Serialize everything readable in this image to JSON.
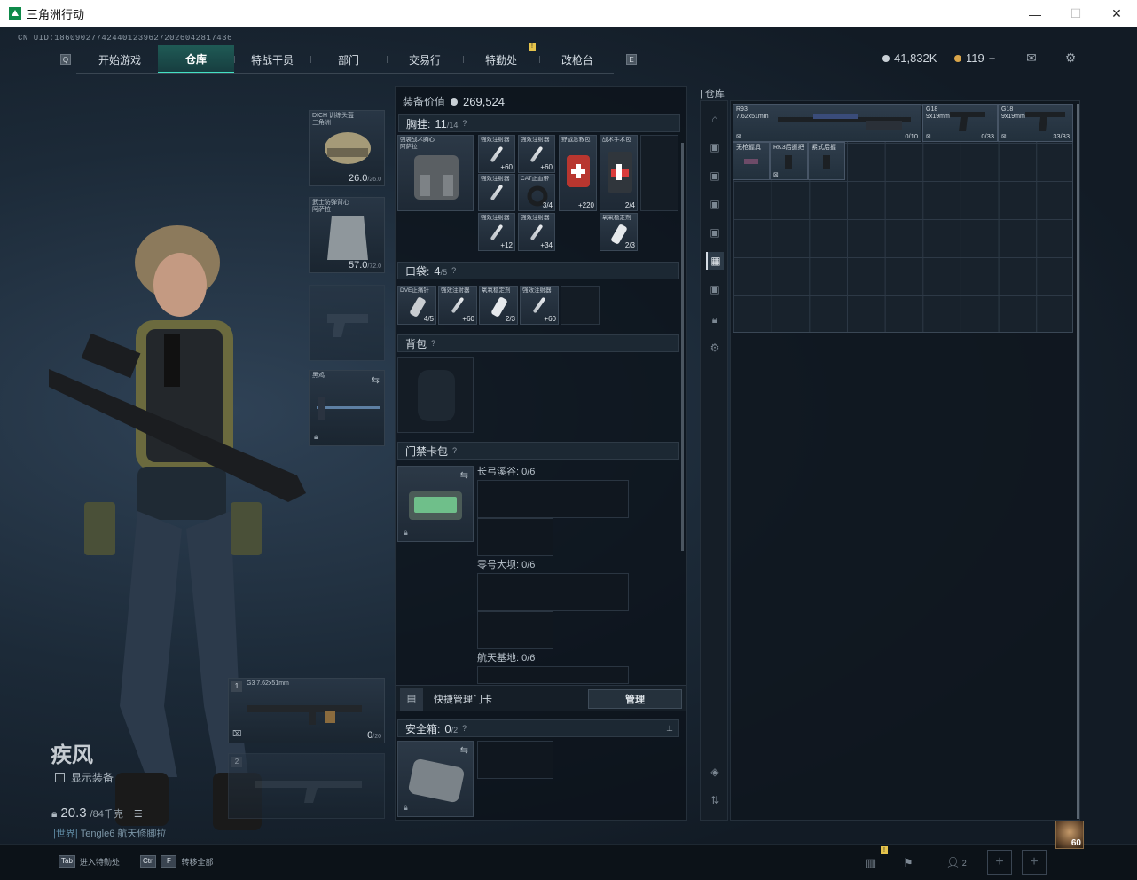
{
  "window": {
    "title": "三角洲行动",
    "minimize": "—",
    "maximize": "☐",
    "close": "✕"
  },
  "uid": "CN UID:1860902774244012396272026042817436",
  "nav": {
    "tabs": [
      {
        "label": "开始游戏"
      },
      {
        "label": "仓库"
      },
      {
        "label": "特战干员"
      },
      {
        "label": "部门"
      },
      {
        "label": "交易行"
      },
      {
        "label": "特勤处"
      },
      {
        "label": "改枪台"
      }
    ],
    "left_key": "Q",
    "right_key": "E",
    "badge": "!"
  },
  "currency": {
    "coins": "41,832K",
    "premium": "119",
    "plus": "+"
  },
  "character": {
    "name": "疾风",
    "show_equipment": "显示装备",
    "weight": "20.3",
    "weight_max": "/84千克",
    "chat_prefix": "|世界|",
    "chat_user": "Tengle6",
    "chat_text": "航天修脚拉"
  },
  "equipment": {
    "helmet": {
      "label": "DICH 训练头盔\n三角洲",
      "durability": "26.0",
      "max": "/26.0"
    },
    "armor": {
      "label": "武士防弹背心\n阿萨拉",
      "durability": "57.0",
      "max": "/72.0"
    },
    "melee": {
      "label": "黑鸡"
    },
    "primary": {
      "index": "1",
      "label": "G3\n7.62x51mm",
      "ammo": "0",
      "ammo_max": "/20"
    },
    "secondary": {
      "index": "2"
    }
  },
  "middle": {
    "value_label": "装备价值",
    "value": "269,524",
    "chest": {
      "title": "胸挂:",
      "cap": "11",
      "cap_max": "/14",
      "rig_label": "强袭战术胸心\n阿萨拉"
    },
    "chest_items": [
      {
        "label": "强效注射器",
        "count": "+60"
      },
      {
        "label": "强效注射器",
        "count": "+60"
      },
      {
        "label": "野战急救包",
        "count": "+220"
      },
      {
        "label": "战术手术包",
        "count": "2/4"
      },
      {
        "label": "强效注射器",
        "count": "+60"
      },
      {
        "label": "CAT止血带",
        "count": "3/4"
      },
      {
        "label": "强效注射器",
        "count": "+12"
      },
      {
        "label": "强效注射器",
        "count": "+34"
      },
      {
        "label": "氧氧稳定剂",
        "count": "2/3"
      }
    ],
    "pocket": {
      "title": "口袋:",
      "cap": "4",
      "cap_max": "/5"
    },
    "pocket_items": [
      {
        "label": "DVE止痛针",
        "count": "4/5"
      },
      {
        "label": "强效注射器",
        "count": "+60"
      },
      {
        "label": "氧氧稳定剂",
        "count": "2/3"
      },
      {
        "label": "强效注射器",
        "count": "+60"
      }
    ],
    "backpack": {
      "title": "背包"
    },
    "keycard": {
      "title": "门禁卡包",
      "areas": [
        {
          "label": "长弓溪谷: 0/6"
        },
        {
          "label": "零号大坝: 0/6"
        },
        {
          "label": "航天基地: 0/6"
        }
      ]
    },
    "quick_card": {
      "label": "快捷管理门卡",
      "button": "管理"
    },
    "safebox": {
      "title": "安全箱:",
      "cap": "0",
      "cap_max": "/2",
      "pin": "📌"
    },
    "help": "?"
  },
  "warehouse": {
    "title": "仓库",
    "items": [
      {
        "label": "R93\n7.62x51mm",
        "count": "0/10"
      },
      {
        "label": "G18\n9x19mm",
        "count": "0/33"
      },
      {
        "label": "G18\n9x19mm",
        "count": "33/33"
      },
      {
        "label": "无枪握具",
        "count": ""
      },
      {
        "label": "RK3后握把",
        "count": ""
      },
      {
        "label": "紧式后握",
        "count": ""
      }
    ]
  },
  "bottom": {
    "hint1_key": "Tab",
    "hint1": "进入特勤处",
    "hint2_key1": "Ctrl",
    "hint2_key2": "F",
    "hint2": "转移全部",
    "friends": "2",
    "level": "60"
  }
}
